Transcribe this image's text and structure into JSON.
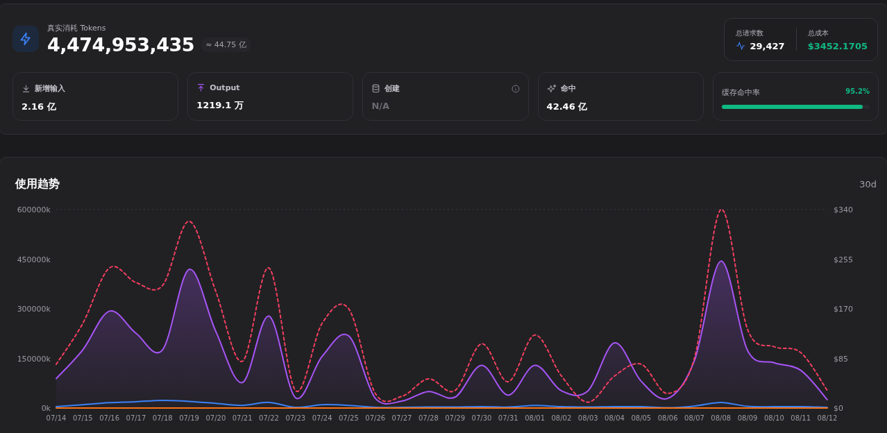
{
  "summary": {
    "label": "真实消耗 Tokens",
    "total": "4,474,953,435",
    "approx": "≈ 44.75 亿",
    "totals": [
      {
        "kind": "requests",
        "label": "总请求数",
        "value": "29,427"
      },
      {
        "kind": "cost",
        "label": "总成本",
        "value": "$3452.1705"
      }
    ],
    "stats": [
      {
        "kind": "input",
        "label": "新增输入",
        "value": "2.16 亿",
        "disabled": false
      },
      {
        "kind": "output",
        "label": "Output",
        "value": "1219.1 万",
        "disabled": false
      },
      {
        "kind": "create",
        "label": "创建",
        "value": "N/A",
        "disabled": true,
        "info": true
      },
      {
        "kind": "hit",
        "label": "命中",
        "value": "42.46 亿",
        "disabled": false
      }
    ],
    "cache": {
      "label": "缓存命中率",
      "reading": "95.2%",
      "level": 0.952
    }
  },
  "trend": {
    "title": "使用趋势",
    "range": "30d",
    "chart_data": {
      "type": "line",
      "categories": [
        "07/14",
        "07/15",
        "07/16",
        "07/17",
        "07/18",
        "07/19",
        "07/20",
        "07/21",
        "07/22",
        "07/23",
        "07/24",
        "07/25",
        "07/26",
        "07/27",
        "07/28",
        "07/29",
        "07/30",
        "07/31",
        "08/01",
        "08/02",
        "08/03",
        "08/04",
        "08/05",
        "08/06",
        "08/07",
        "08/08",
        "08/09",
        "08/10",
        "08/11",
        "08/12"
      ],
      "ylim": [
        0,
        600000
      ],
      "yticks": [
        {
          "value": 0,
          "label": "0k"
        },
        {
          "value": 150000,
          "label": "150000k"
        },
        {
          "value": 300000,
          "label": "300000k"
        },
        {
          "value": 450000,
          "label": "450000k"
        },
        {
          "value": 600000,
          "label": "600000k"
        }
      ],
      "y2lim": [
        0,
        340
      ],
      "y2ticks": [
        {
          "value": 0,
          "label": "$0"
        },
        {
          "value": 85,
          "label": "$85"
        },
        {
          "value": 170,
          "label": "$170"
        },
        {
          "value": 255,
          "label": "$255"
        },
        {
          "value": 340,
          "label": "$340"
        }
      ],
      "series": [
        {
          "color": "#a855f7",
          "type": "area",
          "values": [
            89000,
            176000,
            293000,
            226000,
            176000,
            419000,
            232000,
            77000,
            278000,
            31000,
            156000,
            218000,
            29000,
            21000,
            50000,
            33000,
            129000,
            39000,
            129000,
            52000,
            52000,
            197000,
            81000,
            29000,
            143000,
            444000,
            174000,
            137000,
            114000,
            25000
          ]
        },
        {
          "color": "#3b82f6",
          "values": [
            4000,
            10000,
            16000,
            19000,
            23000,
            20000,
            14000,
            8000,
            17000,
            2000,
            10000,
            8000,
            2000,
            2000,
            3000,
            3000,
            4000,
            3000,
            8000,
            4000,
            3000,
            4000,
            4000,
            1000,
            6000,
            17000,
            5000,
            4000,
            4000,
            2000
          ]
        },
        {
          "color": "#f97316",
          "values": [
            0,
            0,
            0,
            0,
            0,
            0,
            0,
            0,
            0,
            0,
            0,
            0,
            0,
            0,
            0,
            0,
            0,
            0,
            0,
            0,
            0,
            0,
            0,
            0,
            0,
            0,
            0,
            0,
            0,
            0
          ]
        },
        {
          "color": "#f43f5e",
          "axis": "y2",
          "line_style": "dashed",
          "values": [
            75,
            145,
            240,
            215,
            210,
            320,
            200,
            80,
            240,
            30,
            145,
            170,
            25,
            20,
            50,
            30,
            110,
            45,
            125,
            55,
            10,
            55,
            75,
            25,
            85,
            340,
            135,
            105,
            95,
            30
          ]
        }
      ]
    }
  }
}
